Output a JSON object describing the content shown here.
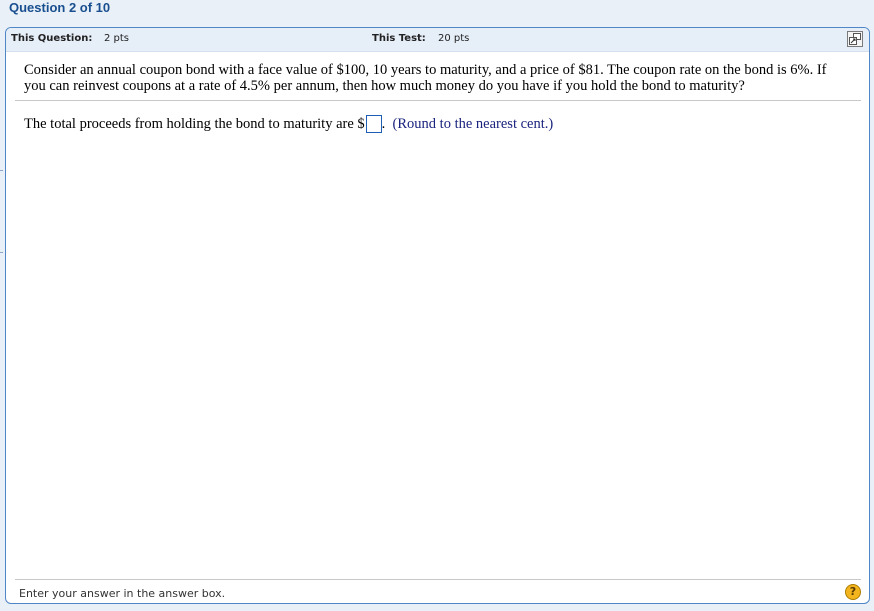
{
  "heading": {
    "title": "Question 2 of 10"
  },
  "header": {
    "this_question_label": "This Question:",
    "this_question_value": "2 pts",
    "this_test_label": "This Test:",
    "this_test_value": "20 pts",
    "expand_icon": "expand-window-icon"
  },
  "question": {
    "text": "Consider an annual coupon bond with a face value of $100, 10 years to maturity, and a price of $81.  The coupon rate on the bond is 6%.  If you can reinvest coupons at a rate of 4.5% per annum, then how much money do you have if you hold the bond to maturity?",
    "answer_prefix": "The total proceeds from holding the bond to maturity are $",
    "answer_value": "",
    "answer_suffix": ".",
    "round_note": "(Round to the nearest cent.)"
  },
  "footer": {
    "instruction": "Enter your answer in the answer box.",
    "help_glyph": "?",
    "help_icon": "help-icon"
  },
  "colors": {
    "heading": "#1a4f8f",
    "panel_border": "#4f86c6",
    "header_bg": "#e6eef8",
    "answer_box_border": "#1d5fb5",
    "round_note": "#1a237e",
    "help_button": "#f2b51d"
  }
}
